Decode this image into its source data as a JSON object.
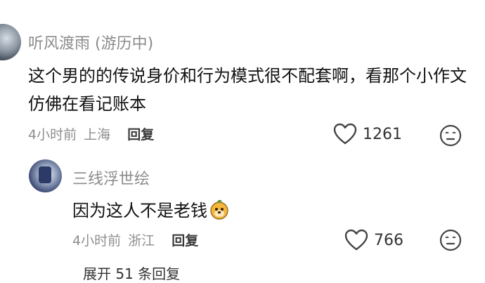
{
  "comment": {
    "username": "听风渡雨 (游历中)",
    "text": "这个男的的传说身价和行为模式很不配套啊，看那个小作文仿佛在看记账本",
    "time": "4小时前",
    "location": "上海",
    "reply_label": "回复",
    "likes": "1261"
  },
  "reply": {
    "username": "三线浮世绘",
    "text": "因为这人不是老钱",
    "time": "4小时前",
    "location": "浙江",
    "reply_label": "回复",
    "likes": "766"
  },
  "expand_label": "展开 51 条回复",
  "icons": {
    "like": "heart-outline-icon",
    "react": "neutral-face-icon",
    "inline_emoji": "dog-face-emoji"
  }
}
